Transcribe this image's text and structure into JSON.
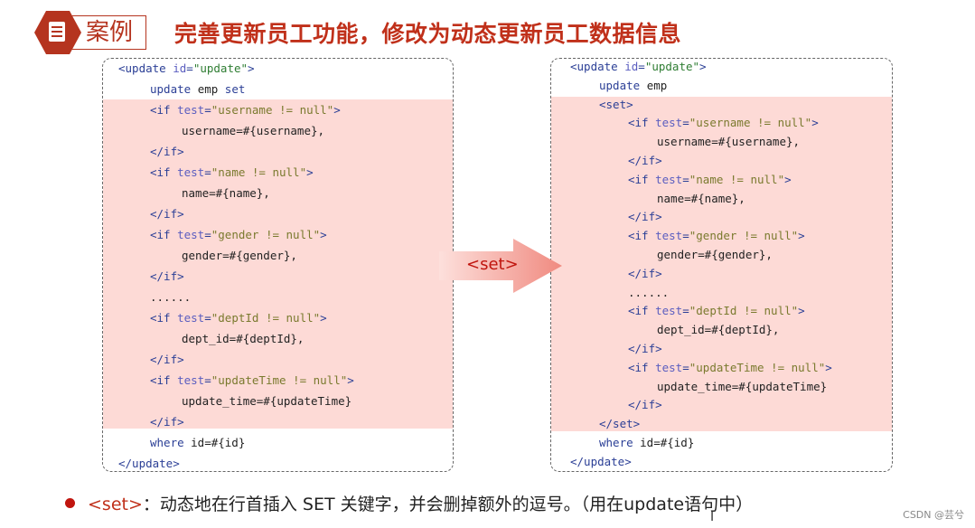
{
  "header": {
    "badge_icon": "document-icon",
    "tag": "案例",
    "title": "完善更新员工功能，修改为动态更新员工数据信息"
  },
  "colors": {
    "accent": "#c0301a",
    "highlight": "#fddad6"
  },
  "left_code": [
    {
      "i": 0,
      "t": [
        [
          "tag",
          "<update "
        ],
        [
          "attr",
          "id"
        ],
        [
          "tag",
          "="
        ],
        [
          "str",
          "\"update\""
        ],
        [
          "tag",
          ">"
        ]
      ]
    },
    {
      "i": 1,
      "t": [
        [
          "kw",
          "update "
        ],
        [
          "txt",
          "emp "
        ],
        [
          "kw",
          "set"
        ]
      ]
    },
    {
      "i": 1,
      "t": [
        [
          "tag",
          "<if "
        ],
        [
          "attr",
          "test"
        ],
        [
          "tag",
          "="
        ],
        [
          "val",
          "\"username != null\""
        ],
        [
          "tag",
          ">"
        ]
      ]
    },
    {
      "i": 2,
      "t": [
        [
          "txt",
          "username=#{username},"
        ]
      ]
    },
    {
      "i": 1,
      "t": [
        [
          "tag",
          "</if>"
        ]
      ]
    },
    {
      "i": 1,
      "t": [
        [
          "tag",
          "<if "
        ],
        [
          "attr",
          "test"
        ],
        [
          "tag",
          "="
        ],
        [
          "val",
          "\"name != null\""
        ],
        [
          "tag",
          ">"
        ]
      ]
    },
    {
      "i": 2,
      "t": [
        [
          "txt",
          "name=#{name},"
        ]
      ]
    },
    {
      "i": 1,
      "t": [
        [
          "tag",
          "</if>"
        ]
      ]
    },
    {
      "i": 1,
      "t": [
        [
          "tag",
          "<if "
        ],
        [
          "attr",
          "test"
        ],
        [
          "tag",
          "="
        ],
        [
          "val",
          "\"gender != null\""
        ],
        [
          "tag",
          ">"
        ]
      ]
    },
    {
      "i": 2,
      "t": [
        [
          "txt",
          "gender=#{gender},"
        ]
      ]
    },
    {
      "i": 1,
      "t": [
        [
          "tag",
          "</if>"
        ]
      ]
    },
    {
      "i": 1,
      "t": [
        [
          "txt",
          "......"
        ]
      ]
    },
    {
      "i": 1,
      "t": [
        [
          "tag",
          "<if "
        ],
        [
          "attr",
          "test"
        ],
        [
          "tag",
          "="
        ],
        [
          "val",
          "\"deptId != null\""
        ],
        [
          "tag",
          ">"
        ]
      ]
    },
    {
      "i": 2,
      "t": [
        [
          "txt",
          "dept_id=#{deptId},"
        ]
      ]
    },
    {
      "i": 1,
      "t": [
        [
          "tag",
          "</if>"
        ]
      ]
    },
    {
      "i": 1,
      "t": [
        [
          "tag",
          "<if "
        ],
        [
          "attr",
          "test"
        ],
        [
          "tag",
          "="
        ],
        [
          "val",
          "\"updateTime != null\""
        ],
        [
          "tag",
          ">"
        ]
      ]
    },
    {
      "i": 2,
      "t": [
        [
          "txt",
          "update_time=#{updateTime}"
        ]
      ]
    },
    {
      "i": 1,
      "t": [
        [
          "tag",
          "</if>"
        ]
      ]
    },
    {
      "i": 1,
      "t": [
        [
          "kw",
          "where "
        ],
        [
          "txt",
          "id=#{id}"
        ]
      ]
    },
    {
      "i": 0,
      "t": [
        [
          "tag",
          "</update>"
        ]
      ]
    }
  ],
  "right_code": [
    {
      "i": 0,
      "t": [
        [
          "tag",
          "<update "
        ],
        [
          "attr",
          "id"
        ],
        [
          "tag",
          "="
        ],
        [
          "str",
          "\"update\""
        ],
        [
          "tag",
          ">"
        ]
      ]
    },
    {
      "i": 1,
      "t": [
        [
          "kw",
          "update "
        ],
        [
          "txt",
          "emp"
        ]
      ]
    },
    {
      "i": 1,
      "t": [
        [
          "tag",
          "<set>"
        ]
      ]
    },
    {
      "i": 2,
      "t": [
        [
          "tag",
          "<if "
        ],
        [
          "attr",
          "test"
        ],
        [
          "tag",
          "="
        ],
        [
          "val",
          "\"username != null\""
        ],
        [
          "tag",
          ">"
        ]
      ]
    },
    {
      "i": 3,
      "t": [
        [
          "txt",
          "username=#{username},"
        ]
      ]
    },
    {
      "i": 2,
      "t": [
        [
          "tag",
          "</if>"
        ]
      ]
    },
    {
      "i": 2,
      "t": [
        [
          "tag",
          "<if "
        ],
        [
          "attr",
          "test"
        ],
        [
          "tag",
          "="
        ],
        [
          "val",
          "\"name != null\""
        ],
        [
          "tag",
          ">"
        ]
      ]
    },
    {
      "i": 3,
      "t": [
        [
          "txt",
          "name=#{name},"
        ]
      ]
    },
    {
      "i": 2,
      "t": [
        [
          "tag",
          "</if>"
        ]
      ]
    },
    {
      "i": 2,
      "t": [
        [
          "tag",
          "<if "
        ],
        [
          "attr",
          "test"
        ],
        [
          "tag",
          "="
        ],
        [
          "val",
          "\"gender != null\""
        ],
        [
          "tag",
          ">"
        ]
      ]
    },
    {
      "i": 3,
      "t": [
        [
          "txt",
          "gender=#{gender},"
        ]
      ]
    },
    {
      "i": 2,
      "t": [
        [
          "tag",
          "</if>"
        ]
      ]
    },
    {
      "i": 2,
      "t": [
        [
          "txt",
          "......"
        ]
      ]
    },
    {
      "i": 2,
      "t": [
        [
          "tag",
          "<if "
        ],
        [
          "attr",
          "test"
        ],
        [
          "tag",
          "="
        ],
        [
          "val",
          "\"deptId != null\""
        ],
        [
          "tag",
          ">"
        ]
      ]
    },
    {
      "i": 3,
      "t": [
        [
          "txt",
          "dept_id=#{deptId},"
        ]
      ]
    },
    {
      "i": 2,
      "t": [
        [
          "tag",
          "</if>"
        ]
      ]
    },
    {
      "i": 2,
      "t": [
        [
          "tag",
          "<if "
        ],
        [
          "attr",
          "test"
        ],
        [
          "tag",
          "="
        ],
        [
          "val",
          "\"updateTime != null\""
        ],
        [
          "tag",
          ">"
        ]
      ]
    },
    {
      "i": 3,
      "t": [
        [
          "txt",
          "update_time=#{updateTime}"
        ]
      ]
    },
    {
      "i": 2,
      "t": [
        [
          "tag",
          "</if>"
        ]
      ]
    },
    {
      "i": 1,
      "t": [
        [
          "tag",
          "</set>"
        ]
      ]
    },
    {
      "i": 1,
      "t": [
        [
          "kw",
          "where "
        ],
        [
          "txt",
          "id=#{id}"
        ]
      ]
    },
    {
      "i": 0,
      "t": [
        [
          "tag",
          "</update>"
        ]
      ]
    }
  ],
  "arrow": {
    "label": "<set>"
  },
  "note": {
    "keyword": "<set>",
    "text": "：动态地在行首插入 SET 关键字，并会删掉额外的逗号。（用在update语句中）"
  },
  "watermark": "CSDN @芸兮"
}
